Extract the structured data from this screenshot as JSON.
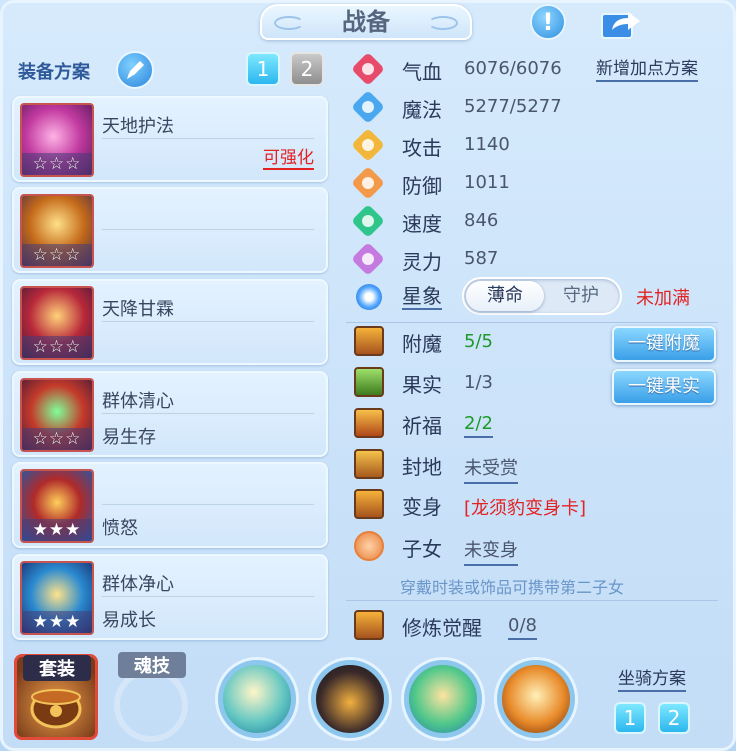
{
  "header": {
    "title": "战备",
    "help_glyph": "!"
  },
  "left": {
    "plan_label": "装备方案",
    "plan_tabs": [
      "1",
      "2"
    ],
    "equipment": [
      {
        "name1": "天地护法",
        "name2": "",
        "status": "可强化",
        "stars": "☆☆☆",
        "star_style": "hollow"
      },
      {
        "name1": "",
        "name2": "",
        "status": "",
        "stars": "☆☆☆",
        "star_style": "hollow"
      },
      {
        "name1": "天降甘霖",
        "name2": "",
        "status": "",
        "stars": "☆☆☆",
        "star_style": "hollow"
      },
      {
        "name1": "群体清心",
        "name2": "易生存",
        "status": "",
        "stars": "☆☆☆",
        "star_style": "hollow"
      },
      {
        "name1": "",
        "name2": "愤怒",
        "status": "",
        "stars": "★★★",
        "star_style": "filled"
      },
      {
        "name1": "群体净心",
        "name2": "易成长",
        "status": "",
        "stars": "★★★",
        "star_style": "filled"
      }
    ]
  },
  "stats": {
    "new_plan": "新增加点方案",
    "rows": [
      {
        "label": "气血",
        "value": "6076/6076",
        "icon": "heart-icon",
        "color": "#e84a6a"
      },
      {
        "label": "魔法",
        "value": "5277/5277",
        "icon": "mana-icon",
        "color": "#4aa8f0"
      },
      {
        "label": "攻击",
        "value": "1140",
        "icon": "sword-icon",
        "color": "#f2b63a"
      },
      {
        "label": "防御",
        "value": "1011",
        "icon": "shield-icon",
        "color": "#f39a4a"
      },
      {
        "label": "速度",
        "value": "846",
        "icon": "speed-icon",
        "color": "#2ec68a"
      },
      {
        "label": "灵力",
        "value": "587",
        "icon": "spirit-icon",
        "color": "#c57ae0"
      }
    ],
    "star_sign": {
      "label": "星象",
      "option_on": "薄命",
      "option_off": "守护",
      "status": "未加满"
    }
  },
  "extras": {
    "rows": [
      {
        "label": "附魔",
        "value": "5/5",
        "icon": "enchant-icon",
        "style": "green"
      },
      {
        "label": "果实",
        "value": "1/3",
        "icon": "fruit-icon",
        "style": "plain"
      },
      {
        "label": "祈福",
        "value": "2/2",
        "icon": "bless-icon",
        "style": "green-link"
      },
      {
        "label": "封地",
        "value": "未受赏",
        "icon": "fief-icon",
        "style": "link"
      },
      {
        "label": "变身",
        "value": "[龙须豹变身卡]",
        "icon": "transform-icon",
        "style": "red"
      },
      {
        "label": "子女",
        "value": "未变身",
        "icon": "child-icon",
        "style": "link"
      }
    ],
    "btn_enchant": "一键附魔",
    "btn_fruit": "一键果实",
    "hint": "穿戴时装或饰品可携带第二子女",
    "cultivate_label": "修炼觉醒",
    "cultivate_value": "0/8"
  },
  "bottom": {
    "suit_label": "套装",
    "soul_label": "魂技",
    "mount_label": "坐骑方案",
    "mount_tabs": [
      "1",
      "2"
    ]
  }
}
